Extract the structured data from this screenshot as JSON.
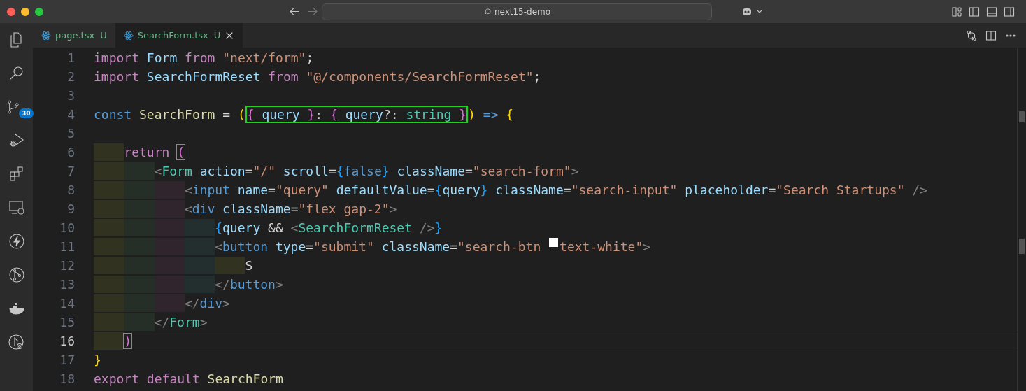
{
  "window": {
    "title": "next15-demo"
  },
  "activity_bar": {
    "items": [
      {
        "kind": "files"
      },
      {
        "kind": "search"
      },
      {
        "kind": "source-control",
        "badge": "30"
      },
      {
        "kind": "run-debug"
      },
      {
        "kind": "extensions"
      },
      {
        "kind": "remote"
      },
      {
        "kind": "lightning"
      },
      {
        "kind": "git-graph"
      },
      {
        "kind": "docker"
      },
      {
        "kind": "git-remote"
      }
    ]
  },
  "tabs": [
    {
      "label": "page.tsx",
      "status": "U",
      "selected": false
    },
    {
      "label": "SearchForm.tsx",
      "status": "U",
      "selected": true
    }
  ],
  "editor": {
    "lines": [
      {
        "number": "1",
        "current": false,
        "tokens": [
          {
            "text": "import",
            "kind": "kw"
          },
          {
            "text": " Form",
            "kind": "id"
          },
          {
            "text": " from",
            "kind": "kw"
          },
          {
            "text": " \"next/form\"",
            "kind": "str"
          },
          {
            "text": ";",
            "kind": "p"
          }
        ]
      },
      {
        "number": "2",
        "current": false,
        "tokens": [
          {
            "text": "import",
            "kind": "kw"
          },
          {
            "text": " SearchFormReset",
            "kind": "id"
          },
          {
            "text": " from",
            "kind": "kw"
          },
          {
            "text": " \"@/components/SearchFormReset\"",
            "kind": "str"
          },
          {
            "text": ";",
            "kind": "p"
          }
        ]
      },
      {
        "number": "3",
        "current": false
      },
      {
        "number": "4",
        "current": false,
        "tokens": [
          {
            "text": "const",
            "kind": "st"
          },
          {
            "text": " SearchForm",
            "kind": "fn"
          },
          {
            "text": " = ",
            "kind": "p"
          },
          {
            "text": "(",
            "kind": "b1"
          },
          {
            "kind": "group",
            "outlined": true,
            "tokens": [
              {
                "text": "{",
                "kind": "b2"
              },
              {
                "text": " query ",
                "kind": "id"
              },
              {
                "text": "}",
                "kind": "b2"
              },
              {
                "text": ": ",
                "kind": "p"
              },
              {
                "text": "{",
                "kind": "b2"
              },
              {
                "text": " query",
                "kind": "id"
              },
              {
                "text": "?: ",
                "kind": "p"
              },
              {
                "text": "string",
                "kind": "ty"
              },
              {
                "text": " }",
                "kind": "b2"
              }
            ]
          },
          {
            "text": ")",
            "kind": "b1"
          },
          {
            "text": " =>",
            "kind": "st"
          },
          {
            "text": " {",
            "kind": "b1"
          }
        ]
      },
      {
        "number": "5",
        "current": false
      },
      {
        "number": "6",
        "current": false,
        "indent_guides": [
          {
            "color": "#323221"
          }
        ],
        "tokens": [
          {
            "text": "return ",
            "kind": "kw"
          },
          {
            "text": "(",
            "kind": "b2",
            "matched": true
          }
        ]
      },
      {
        "number": "7",
        "current": false,
        "indent_guides": [
          {
            "color": "#323221"
          },
          {
            "color": "#252f28"
          }
        ],
        "tokens": [
          {
            "text": "<",
            "kind": "tg"
          },
          {
            "text": "Form",
            "kind": "ty"
          },
          {
            "text": " action",
            "kind": "at"
          },
          {
            "text": "=",
            "kind": "p"
          },
          {
            "text": "\"/\"",
            "kind": "str"
          },
          {
            "text": " scroll",
            "kind": "at"
          },
          {
            "text": "=",
            "kind": "p"
          },
          {
            "text": "{",
            "kind": "b3"
          },
          {
            "text": "false",
            "kind": "st"
          },
          {
            "text": "}",
            "kind": "b3"
          },
          {
            "text": " className",
            "kind": "at"
          },
          {
            "text": "=",
            "kind": "p"
          },
          {
            "text": "\"search-form\"",
            "kind": "str"
          },
          {
            "text": ">",
            "kind": "tg"
          }
        ]
      },
      {
        "number": "8",
        "current": false,
        "indent_guides": [
          {
            "color": "#323221"
          },
          {
            "color": "#252f28"
          },
          {
            "color": "#30242d"
          }
        ],
        "tokens": [
          {
            "text": "<",
            "kind": "tg"
          },
          {
            "text": "input",
            "kind": "st"
          },
          {
            "text": " name",
            "kind": "at"
          },
          {
            "text": "=",
            "kind": "p"
          },
          {
            "text": "\"query\"",
            "kind": "str"
          },
          {
            "text": " defaultValue",
            "kind": "at"
          },
          {
            "text": "=",
            "kind": "p"
          },
          {
            "text": "{",
            "kind": "b3"
          },
          {
            "text": "query",
            "kind": "id"
          },
          {
            "text": "}",
            "kind": "b3"
          },
          {
            "text": " className",
            "kind": "at"
          },
          {
            "text": "=",
            "kind": "p"
          },
          {
            "text": "\"search-input\"",
            "kind": "str"
          },
          {
            "text": " placeholder",
            "kind": "at"
          },
          {
            "text": "=",
            "kind": "p"
          },
          {
            "text": "\"Search Startups\"",
            "kind": "str"
          },
          {
            "text": " />",
            "kind": "tg"
          }
        ]
      },
      {
        "number": "9",
        "current": false,
        "indent_guides": [
          {
            "color": "#323221"
          },
          {
            "color": "#252f28"
          },
          {
            "color": "#30242d"
          }
        ],
        "tokens": [
          {
            "text": "<",
            "kind": "tg"
          },
          {
            "text": "div",
            "kind": "st"
          },
          {
            "text": " className",
            "kind": "at"
          },
          {
            "text": "=",
            "kind": "p"
          },
          {
            "text": "\"flex gap-2\"",
            "kind": "str"
          },
          {
            "text": ">",
            "kind": "tg"
          }
        ]
      },
      {
        "number": "10",
        "current": false,
        "indent_guides": [
          {
            "color": "#323221"
          },
          {
            "color": "#252f28"
          },
          {
            "color": "#30242d"
          },
          {
            "color": "#232e2e"
          }
        ],
        "tokens": [
          {
            "text": "{",
            "kind": "b3"
          },
          {
            "text": "query",
            "kind": "id"
          },
          {
            "text": " && ",
            "kind": "p"
          },
          {
            "text": "<",
            "kind": "tg"
          },
          {
            "text": "SearchFormReset",
            "kind": "ty"
          },
          {
            "text": " />",
            "kind": "tg"
          },
          {
            "text": "}",
            "kind": "b3"
          }
        ]
      },
      {
        "number": "11",
        "current": false,
        "indent_guides": [
          {
            "color": "#323221"
          },
          {
            "color": "#252f28"
          },
          {
            "color": "#30242d"
          },
          {
            "color": "#232e2e"
          }
        ],
        "tokens": [
          {
            "text": "<",
            "kind": "tg"
          },
          {
            "text": "button",
            "kind": "st"
          },
          {
            "text": " type",
            "kind": "at"
          },
          {
            "text": "=",
            "kind": "p"
          },
          {
            "text": "\"submit\"",
            "kind": "str"
          },
          {
            "text": " className",
            "kind": "at"
          },
          {
            "text": "=",
            "kind": "p"
          },
          {
            "text": "\"search-btn ",
            "kind": "str"
          },
          {
            "kind": "swatch",
            "color": "#ffffff"
          },
          {
            "text": "text-white\"",
            "kind": "str"
          },
          {
            "text": ">",
            "kind": "tg"
          }
        ]
      },
      {
        "number": "12",
        "current": false,
        "indent_guides": [
          {
            "color": "#323221"
          },
          {
            "color": "#252f28"
          },
          {
            "color": "#30242d"
          },
          {
            "color": "#232e2e"
          },
          {
            "color": "#323221"
          }
        ],
        "tokens": [
          {
            "text": "S",
            "kind": "p"
          }
        ]
      },
      {
        "number": "13",
        "current": false,
        "indent_guides": [
          {
            "color": "#323221"
          },
          {
            "color": "#252f28"
          },
          {
            "color": "#30242d"
          },
          {
            "color": "#232e2e"
          }
        ],
        "tokens": [
          {
            "text": "</",
            "kind": "tg"
          },
          {
            "text": "button",
            "kind": "st"
          },
          {
            "text": ">",
            "kind": "tg"
          }
        ]
      },
      {
        "number": "14",
        "current": false,
        "indent_guides": [
          {
            "color": "#323221"
          },
          {
            "color": "#252f28"
          },
          {
            "color": "#30242d"
          }
        ],
        "tokens": [
          {
            "text": "</",
            "kind": "tg"
          },
          {
            "text": "div",
            "kind": "st"
          },
          {
            "text": ">",
            "kind": "tg"
          }
        ]
      },
      {
        "number": "15",
        "current": false,
        "indent_guides": [
          {
            "color": "#323221"
          },
          {
            "color": "#252f28"
          }
        ],
        "tokens": [
          {
            "text": "</",
            "kind": "tg"
          },
          {
            "text": "Form",
            "kind": "ty"
          },
          {
            "text": ">",
            "kind": "tg"
          }
        ]
      },
      {
        "number": "16",
        "current": true,
        "indent_guides": [
          {
            "color": "#323221"
          }
        ],
        "tokens": [
          {
            "text": ")",
            "kind": "b2",
            "matched": true
          }
        ]
      },
      {
        "number": "17",
        "current": false,
        "tokens": [
          {
            "text": "}",
            "kind": "b1"
          }
        ]
      },
      {
        "number": "18",
        "current": false,
        "tokens": [
          {
            "text": "export",
            "kind": "kw"
          },
          {
            "text": " default",
            "kind": "kw"
          },
          {
            "text": " SearchForm",
            "kind": "fn"
          }
        ]
      }
    ]
  }
}
